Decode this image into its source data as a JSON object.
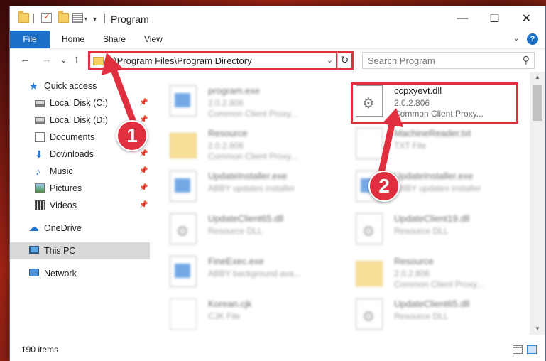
{
  "window": {
    "title": "Program",
    "minimize_glyph": "—",
    "maximize_glyph": "☐",
    "close_glyph": "✕"
  },
  "ribbon": {
    "tabs": [
      "File",
      "Home",
      "Share",
      "View"
    ],
    "expand_glyph": "⌄",
    "help_glyph": "?"
  },
  "navigation": {
    "back_glyph": "←",
    "forward_glyph": "→",
    "recent_glyph": "⌄",
    "up_glyph": "↑",
    "address_path": "C:\\Program Files\\Program Directory",
    "refresh_glyph": "↻",
    "search_placeholder": "Search Program",
    "search_glyph": "⚲"
  },
  "sidebar": {
    "items": [
      {
        "label": "Quick access",
        "icon": "star-icon",
        "pinned": false
      },
      {
        "label": "Local Disk (C:)",
        "icon": "disk-icon",
        "pinned": true
      },
      {
        "label": "Local Disk (D:)",
        "icon": "disk-icon",
        "pinned": true
      },
      {
        "label": "Documents",
        "icon": "documents-icon",
        "pinned": true
      },
      {
        "label": "Downloads",
        "icon": "download-icon",
        "pinned": true
      },
      {
        "label": "Music",
        "icon": "music-icon",
        "pinned": true
      },
      {
        "label": "Pictures",
        "icon": "pictures-icon",
        "pinned": true
      },
      {
        "label": "Videos",
        "icon": "videos-icon",
        "pinned": true
      },
      {
        "label": "OneDrive",
        "icon": "onedrive-icon",
        "pinned": false
      },
      {
        "label": "This PC",
        "icon": "this-pc-icon",
        "pinned": false,
        "selected": true
      },
      {
        "label": "Network",
        "icon": "network-icon",
        "pinned": false
      }
    ],
    "pin_glyph": "📌"
  },
  "files": [
    {
      "name": "program.exe",
      "line1": "2.0.2.806",
      "line2": "Common Client Proxy...",
      "icon": "exe-icon",
      "blurred": true
    },
    {
      "name": "ccpxyevt.dll",
      "line1": "2.0.2.806",
      "line2": "Common Client Proxy...",
      "icon": "dll-icon",
      "blurred": false
    },
    {
      "name": "Resource",
      "line1": "2.0.2.806",
      "line2": "Common Client Proxy...",
      "icon": "folder-icon",
      "blurred": true
    },
    {
      "name": "MachineReader.txt",
      "line1": "TXT File",
      "line2": "",
      "icon": "text-file-icon",
      "blurred": true
    },
    {
      "name": "UpdateInstaller.exe",
      "line1": "ABBY updates installer",
      "line2": "",
      "icon": "exe-icon",
      "blurred": true
    },
    {
      "name": "UpdateInstaller.exe",
      "line1": "ABBY updates installer",
      "line2": "",
      "icon": "exe-icon",
      "blurred": true
    },
    {
      "name": "UpdateClient65.dll",
      "line1": "Resource DLL",
      "line2": "",
      "icon": "dll-icon",
      "blurred": true
    },
    {
      "name": "UpdateClient19.dll",
      "line1": "Resource DLL",
      "line2": "",
      "icon": "dll-icon",
      "blurred": true
    },
    {
      "name": "FineExec.exe",
      "line1": "ABBY background ava...",
      "line2": "",
      "icon": "exe-icon",
      "blurred": true
    },
    {
      "name": "Resource",
      "line1": "2.0.2.806",
      "line2": "Common Client Proxy...",
      "icon": "folder-icon",
      "blurred": true
    },
    {
      "name": "Korean.cjk",
      "line1": "CJK File",
      "line2": "",
      "icon": "cjk-file-icon",
      "blurred": true
    },
    {
      "name": "UpdateClient65.dll",
      "line1": "Resource DLL",
      "line2": "",
      "icon": "dll-icon",
      "blurred": true
    }
  ],
  "status": {
    "item_count": "190 items"
  },
  "annotations": {
    "step1": "1",
    "step2": "2",
    "highlight_color": "#e03040"
  },
  "colors": {
    "accent": "#1c6fc7",
    "annotation_red": "#e03040"
  }
}
